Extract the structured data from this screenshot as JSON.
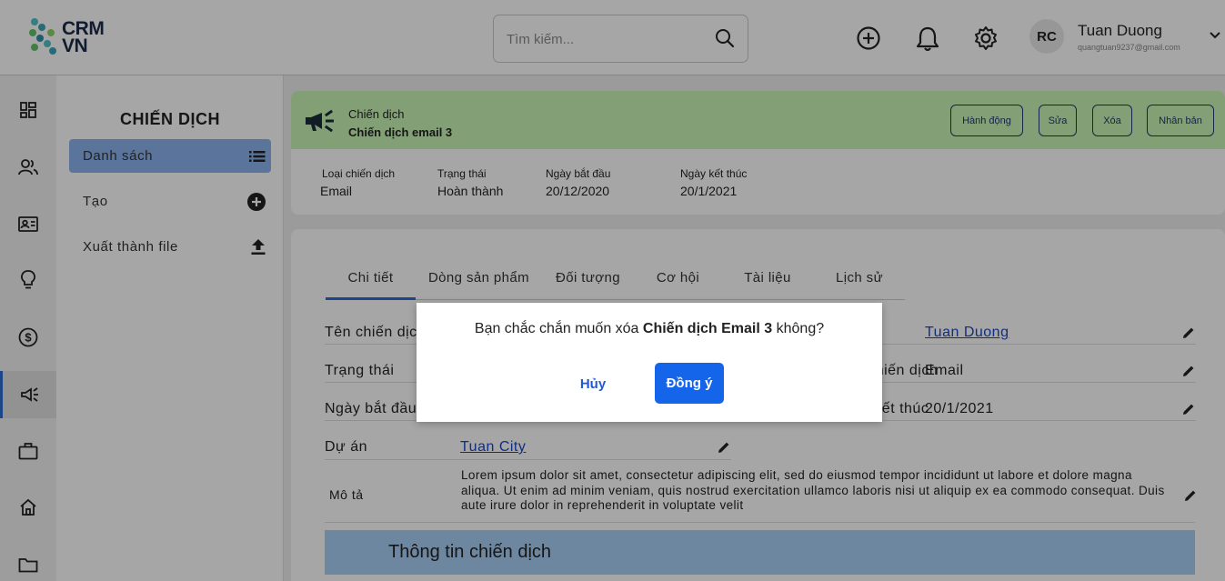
{
  "brand": {
    "line1": "CRM",
    "line2": "VN"
  },
  "search": {
    "placeholder": "Tìm kiếm..."
  },
  "user": {
    "initials": "RC",
    "name": "Tuan Duong",
    "email": "quangtuan9237@gmail.com"
  },
  "colors": {
    "accent": "#2d6cd2",
    "header_band": "#c8f5b4",
    "submenu_active": "#8bb3ee",
    "primary_button": "#1565ea",
    "section_band": "#a9cff6"
  },
  "rail_icons": [
    "dashboard-icon",
    "contacts-icon",
    "id-card-icon",
    "lightbulb-icon",
    "dollar-icon",
    "megaphone-icon",
    "briefcase-icon",
    "home-icon",
    "folder-icon"
  ],
  "submenu": {
    "title": "CHIẾN DỊCH",
    "items": [
      {
        "label": "Danh sách",
        "icon": "list-icon"
      },
      {
        "label": "Tạo",
        "icon": "plus-circle-icon"
      },
      {
        "label": "Xuất thành file",
        "icon": "upload-icon"
      }
    ]
  },
  "campaign_header": {
    "type_label": "Chiến dịch",
    "name": "Chiến dịch email 3",
    "actions": [
      "Hành động",
      "Sửa",
      "Xóa",
      "Nhân bản"
    ],
    "meta": [
      {
        "label": "Loại chiến dịch",
        "value": "Email"
      },
      {
        "label": "Trạng thái",
        "value": "Hoàn thành"
      },
      {
        "label": "Ngày bắt đầu",
        "value": "20/12/2020"
      },
      {
        "label": "Ngày kết thúc",
        "value": "20/1/2021"
      }
    ]
  },
  "tabs": [
    "Chi tiết",
    "Dòng sản phẩm",
    "Đối tượng",
    "Cơ hội",
    "Tài liệu",
    "Lịch sử"
  ],
  "details": {
    "left": [
      {
        "label": "Tên chiến dịch",
        "value": ""
      },
      {
        "label": "Trạng thái",
        "value": ""
      },
      {
        "label": "Ngày bắt đầu",
        "value": ""
      },
      {
        "label": "Dự án",
        "value": "Tuan City"
      }
    ],
    "right": [
      {
        "label": "",
        "value": "Tuan Duong"
      },
      {
        "label": "Loại chiến dịch",
        "value": "Email"
      },
      {
        "label": "Ngày kết thúc",
        "value": "20/1/2021"
      }
    ],
    "description_label": "Mô tả",
    "description": "Lorem ipsum dolor sit amet, consectetur adipiscing elit, sed do eiusmod tempor incididunt ut labore et dolore magna aliqua. Ut enim ad minim veniam, quis nostrud exercitation ullamco laboris nisi ut aliquip ex ea commodo consequat. Duis aute irure dolor in reprehenderit in voluptate velit"
  },
  "section_title": "Thông tin chiến dịch",
  "dialog": {
    "message_before": "Bạn chắc chắn muốn xóa ",
    "message_bold": "Chiến dịch Email 3",
    "message_after": " không?",
    "cancel": "Hủy",
    "confirm": "Đồng ý"
  }
}
